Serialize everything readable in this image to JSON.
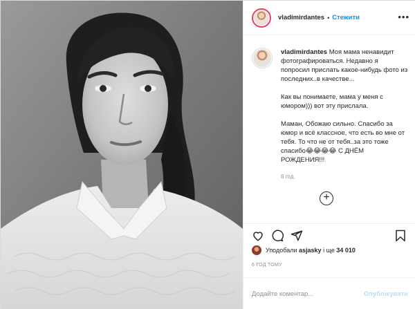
{
  "header": {
    "username": "vladimirdantes",
    "separator": "•",
    "follow_label": "Стежити",
    "more_icon": "more-horizontal-icon"
  },
  "caption": {
    "username": "vladimirdantes",
    "paragraphs": [
      "Моя мама ненавидит фотографироваться. Недавно я попросил прислать какое-нибудь фото из последних..в качестве...",
      "Как вы понимаете, мама у меня с юмором))) вот эту прислала.",
      "Маман, Обожаю сильно. Спасибо за юмор и всё классное, что есть во мне от тебя. То что не от тебя..за это тоже спасибо😂😂😂😂 С ДНЁМ РОЖДЕНИЯ!!!"
    ],
    "time": "6 год."
  },
  "load_more_icon": "plus-circle-icon",
  "actions": {
    "icons": [
      "heart-icon",
      "comment-icon",
      "share-icon",
      "bookmark-icon"
    ]
  },
  "likes": {
    "prefix": "Уподобали",
    "user": "asjasky",
    "middle": "і ще",
    "count": "34 010"
  },
  "ago": "6 ГОД ТОМУ",
  "comment_box": {
    "placeholder": "Додайте коментар...",
    "publish_label": "Опублікувати"
  },
  "colors": {
    "accent": "#0095f6",
    "publish_disabled": "#b2dffc",
    "text": "#262626",
    "secondary": "#8e8e8e"
  }
}
